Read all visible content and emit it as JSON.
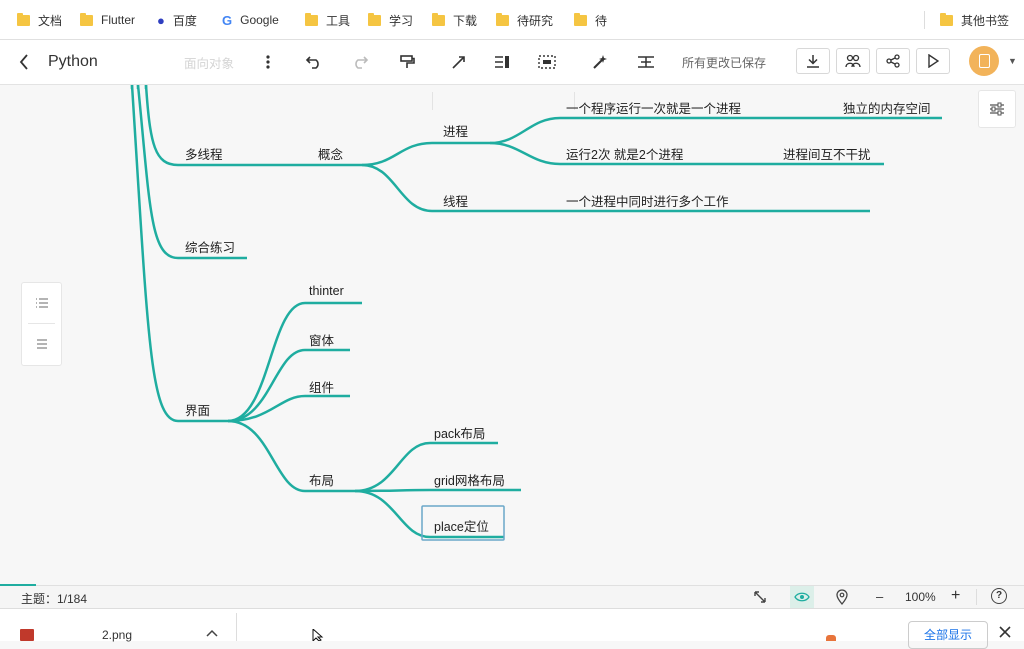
{
  "bookmarks": [
    {
      "label": "文档",
      "icon": "folder-icon"
    },
    {
      "label": "Flutter",
      "icon": "folder-icon"
    },
    {
      "label": "百度",
      "icon": "baidu-icon"
    },
    {
      "label": "Google",
      "icon": "google-icon"
    },
    {
      "label": "工具",
      "icon": "folder-icon"
    },
    {
      "label": "学习",
      "icon": "folder-icon"
    },
    {
      "label": "下载",
      "icon": "folder-icon"
    },
    {
      "label": "待研究",
      "icon": "folder-icon"
    },
    {
      "label": "待",
      "icon": "folder-icon"
    }
  ],
  "bookmarks_other": "其他书签",
  "toolbar": {
    "title": "Python",
    "faded_node": "面向对象",
    "save_status": "所有更改已保存"
  },
  "mindmap": {
    "duoxiancheng": "多线程",
    "gainian": "概念",
    "jincheng": "进程",
    "jincheng_desc1": "一个程序运行一次就是一个进程",
    "jincheng_desc1_sub": "独立的内存空间",
    "jincheng_desc2": "运行2次 就是2个进程",
    "jincheng_desc2_sub": "进程间互不干扰",
    "xiancheng": "线程",
    "xiancheng_desc": "一个进程中同时进行多个工作",
    "zonghe": "综合练习",
    "jiemian": "界面",
    "thinter": "thinter",
    "chuangti": "窗体",
    "zujian": "组件",
    "buju": "布局",
    "pack": "pack布局",
    "grid": "grid网格布局",
    "place": "place定位"
  },
  "colors": {
    "branch": "#1fada0",
    "accent": "#f2b35a",
    "selection": "#6aa7c9"
  },
  "status": {
    "topic_label": "主题：1/184",
    "zoom": "100%",
    "minus": "–",
    "plus": "+",
    "help": "?"
  },
  "downloads": {
    "file": "2.png",
    "show_all": "全部显示"
  }
}
